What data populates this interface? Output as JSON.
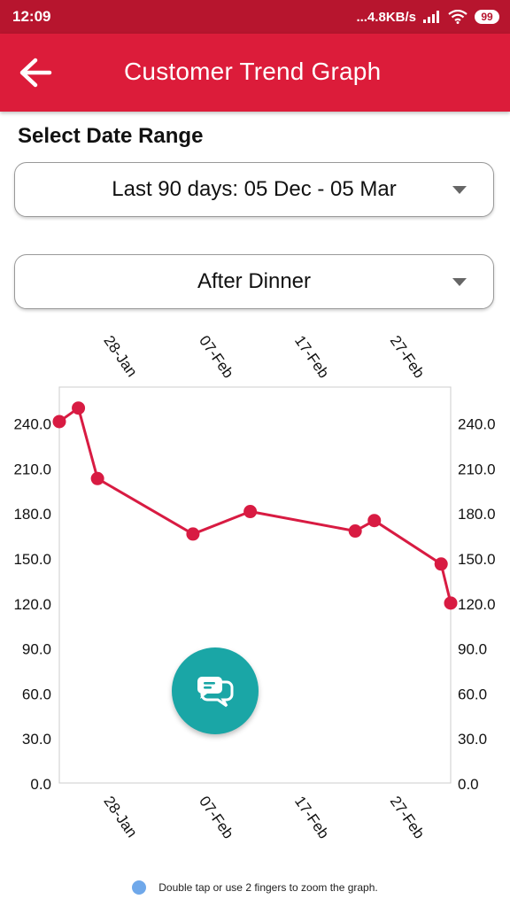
{
  "status_bar": {
    "time": "12:09",
    "network_speed": "...4.8KB/s",
    "battery": "99",
    "icons": [
      "signal-icon",
      "wifi-icon",
      "battery-icon"
    ]
  },
  "app_bar": {
    "title": "Customer Trend Graph",
    "back_icon": "arrow-left-icon",
    "color": "#dc1c3a"
  },
  "date_range": {
    "label": "Select Date Range",
    "selected": "Last 90 days: 05 Dec - 05 Mar"
  },
  "meal_filter": {
    "selected": "After Dinner"
  },
  "chart_data": {
    "type": "line",
    "title": "",
    "xlabel": "",
    "ylabel": "",
    "x_tick_labels": [
      "28-Jan",
      "07-Feb",
      "17-Feb",
      "27-Feb"
    ],
    "y_tick_labels": [
      "0.0",
      "30.0",
      "60.0",
      "90.0",
      "120.0",
      "150.0",
      "180.0",
      "210.0",
      "240.0"
    ],
    "ylim": [
      0,
      264
    ],
    "xlim": [
      "2025-01-23",
      "2025-03-05"
    ],
    "series": [
      {
        "color": "#d81b42",
        "points": [
          {
            "x": "2025-01-23",
            "y": 241
          },
          {
            "x": "2025-01-25",
            "y": 250
          },
          {
            "x": "2025-01-27",
            "y": 203
          },
          {
            "x": "2025-02-06",
            "y": 166
          },
          {
            "x": "2025-02-12",
            "y": 181
          },
          {
            "x": "2025-02-23",
            "y": 168
          },
          {
            "x": "2025-02-25",
            "y": 175
          },
          {
            "x": "2025-03-04",
            "y": 146
          },
          {
            "x": "2025-03-05",
            "y": 120
          }
        ]
      }
    ],
    "grid": false,
    "legend": "none",
    "right_axis_mirror": true
  },
  "fab": {
    "icon": "chat-bubbles-icon",
    "color": "#1aa6a6"
  },
  "hint": {
    "text": "Double tap or use 2 fingers to zoom the graph.",
    "dot_color": "#6fa8ea"
  }
}
